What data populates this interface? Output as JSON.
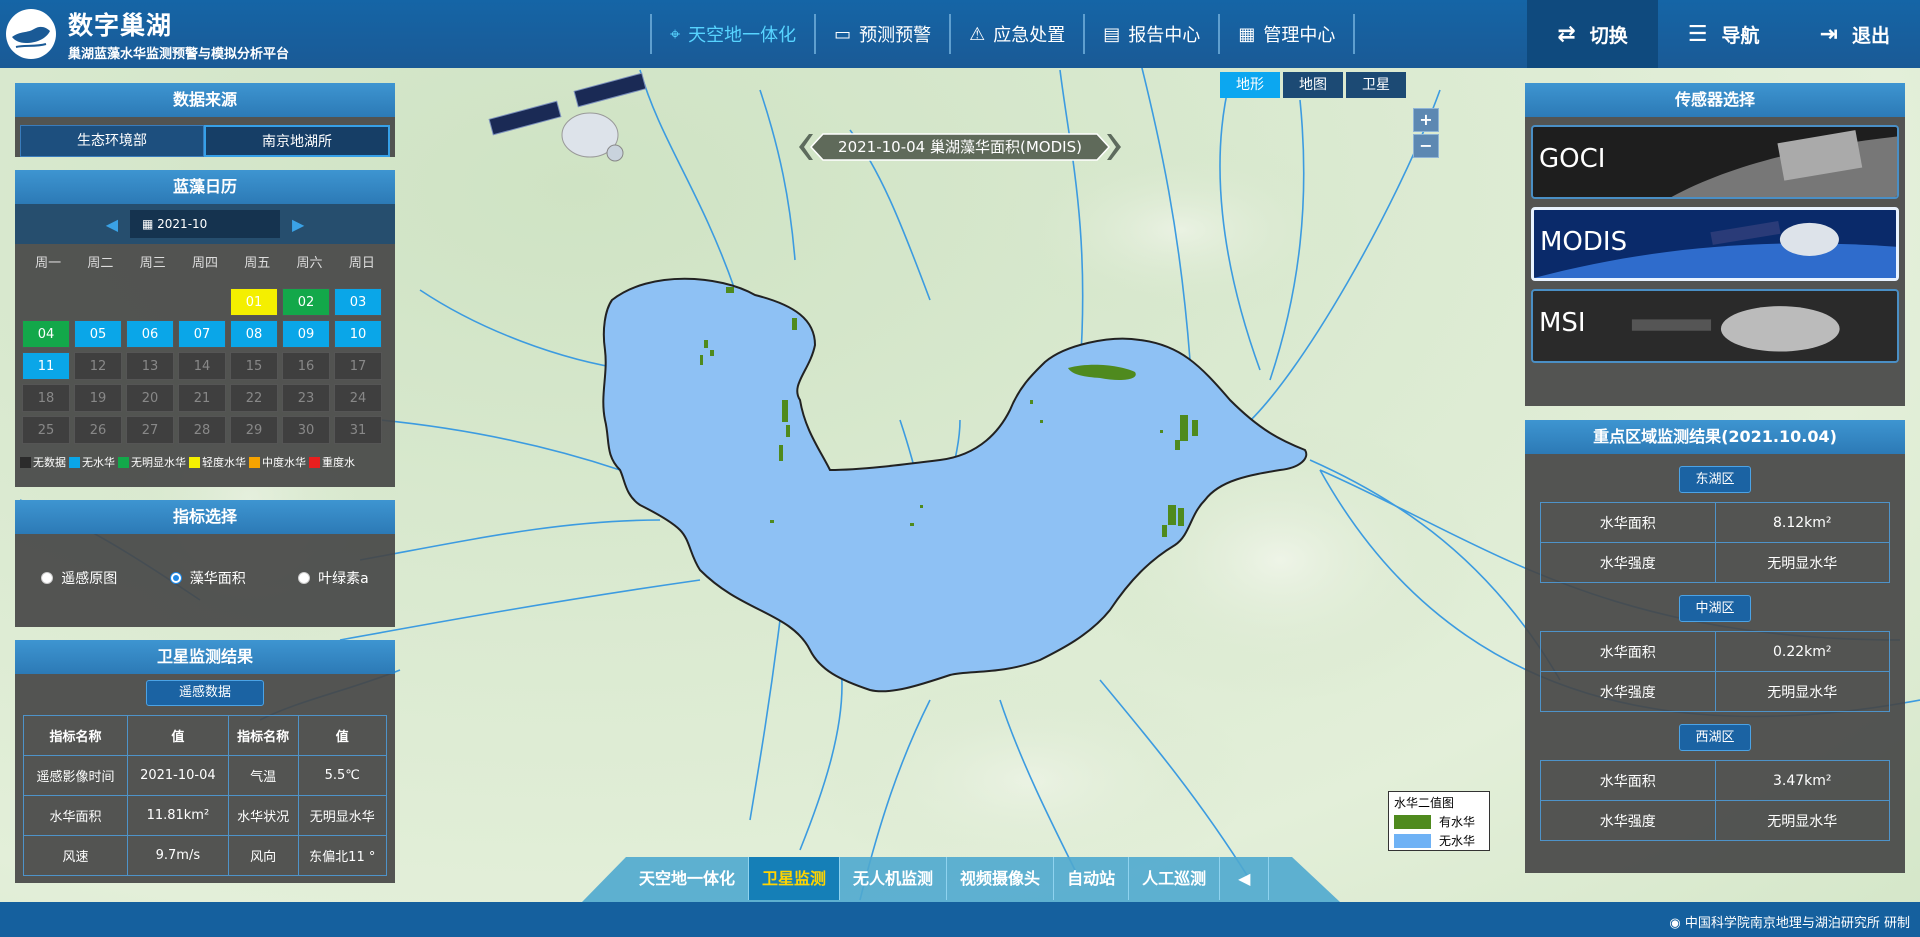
{
  "header": {
    "title": "数字巢湖",
    "subtitle": "巢湖蓝藻水华监测预警与模拟分析平台",
    "nav": [
      {
        "label": "天空地一体化",
        "icon": "location-pin-icon"
      },
      {
        "label": "预测预警",
        "icon": "monitor-chart-icon"
      },
      {
        "label": "应急处置",
        "icon": "alarm-light-icon"
      },
      {
        "label": "报告中心",
        "icon": "report-document-icon"
      },
      {
        "label": "管理中心",
        "icon": "grid-apps-icon"
      }
    ],
    "actions": [
      {
        "label": "切换",
        "icon": "switch-icon"
      },
      {
        "label": "导航",
        "icon": "list-menu-icon"
      },
      {
        "label": "退出",
        "icon": "logout-icon"
      }
    ]
  },
  "data_source": {
    "title": "数据来源",
    "tabs": [
      "生态环境部",
      "南京地湖所"
    ]
  },
  "calendar": {
    "title": "蓝藻日历",
    "month": "2021-10",
    "weekdays": [
      "周一",
      "周二",
      "周三",
      "周四",
      "周五",
      "周六",
      "周日"
    ],
    "days": [
      {
        "d": "01",
        "s": "light"
      },
      {
        "d": "02",
        "s": "nobvious"
      },
      {
        "d": "03",
        "s": "bloom"
      },
      {
        "d": "04",
        "s": "nobvious"
      },
      {
        "d": "05",
        "s": "bloom"
      },
      {
        "d": "06",
        "s": "bloom"
      },
      {
        "d": "07",
        "s": "bloom"
      },
      {
        "d": "08",
        "s": "bloom"
      },
      {
        "d": "09",
        "s": "bloom"
      },
      {
        "d": "10",
        "s": "bloom"
      },
      {
        "d": "11",
        "s": "bloom"
      },
      {
        "d": "12",
        "s": "none"
      },
      {
        "d": "13",
        "s": "none"
      },
      {
        "d": "14",
        "s": "none"
      },
      {
        "d": "15",
        "s": "none"
      },
      {
        "d": "16",
        "s": "none"
      },
      {
        "d": "17",
        "s": "none"
      },
      {
        "d": "18",
        "s": "none"
      },
      {
        "d": "19",
        "s": "none"
      },
      {
        "d": "20",
        "s": "none"
      },
      {
        "d": "21",
        "s": "none"
      },
      {
        "d": "22",
        "s": "none"
      },
      {
        "d": "23",
        "s": "none"
      },
      {
        "d": "24",
        "s": "none"
      },
      {
        "d": "25",
        "s": "none"
      },
      {
        "d": "26",
        "s": "none"
      },
      {
        "d": "27",
        "s": "none"
      },
      {
        "d": "28",
        "s": "none"
      },
      {
        "d": "29",
        "s": "none"
      },
      {
        "d": "30",
        "s": "none"
      },
      {
        "d": "31",
        "s": "none"
      }
    ],
    "legend": [
      {
        "label": "无数据",
        "color": "#2b2b2b"
      },
      {
        "label": "无水华",
        "color": "#0aa6e8"
      },
      {
        "label": "无明显水华",
        "color": "#13a84a"
      },
      {
        "label": "轻度水华",
        "color": "#f4ef00"
      },
      {
        "label": "中度水华",
        "color": "#f5a300"
      },
      {
        "label": "重度水",
        "color": "#e81e1e"
      }
    ]
  },
  "indicator": {
    "title": "指标选择",
    "options": [
      "遥感原图",
      "藻华面积",
      "叶绿素a"
    ],
    "selected": 1
  },
  "satellite_result": {
    "title": "卫星监测结果",
    "button": "遥感数据",
    "headers": [
      "指标名称",
      "值",
      "指标名称",
      "值"
    ],
    "rows": [
      [
        "遥感影像时间",
        "2021-10-04",
        "气温",
        "5.5℃"
      ],
      [
        "水华面积",
        "11.81km²",
        "水华状况",
        "无明显水华"
      ],
      [
        "风速",
        "9.7m/s",
        "风向",
        "东偏北11 °"
      ]
    ]
  },
  "map": {
    "types": [
      "地形",
      "地图",
      "卫星"
    ],
    "active_type": 0,
    "zoom_in": "+",
    "zoom_out": "−",
    "date_banner": "2021-10-04 巢湖藻华面积(MODIS)",
    "legend": {
      "title": "水华二值图",
      "items": [
        {
          "label": "有水华",
          "color": "#4f8a1e"
        },
        {
          "label": "无水华",
          "color": "#6fb2f5"
        }
      ]
    },
    "lake_color": "#8ec1f4",
    "bloom_color": "#4f8a1e"
  },
  "bottom_tabs": {
    "tabs": [
      "天空地一体化",
      "卫星监测",
      "无人机监测",
      "视频摄像头",
      "自动站",
      "人工巡测"
    ],
    "active": 1,
    "collapse": "◀"
  },
  "sensor": {
    "title": "传感器选择",
    "items": [
      "GOCI",
      "MODIS",
      "MSI"
    ],
    "active": 1
  },
  "focus": {
    "title": "重点区域监测结果(2021.10.04)",
    "zones": [
      {
        "name": "东湖区",
        "rows": [
          [
            "水华面积",
            "8.12km²"
          ],
          [
            "水华强度",
            "无明显水华"
          ]
        ]
      },
      {
        "name": "中湖区",
        "rows": [
          [
            "水华面积",
            "0.22km²"
          ],
          [
            "水华强度",
            "无明显水华"
          ]
        ]
      },
      {
        "name": "西湖区",
        "rows": [
          [
            "水华面积",
            "3.47km²"
          ],
          [
            "水华强度",
            "无明显水华"
          ]
        ]
      }
    ]
  },
  "footer": {
    "credit": "中国科学院南京地理与湖泊研究所 研制"
  }
}
